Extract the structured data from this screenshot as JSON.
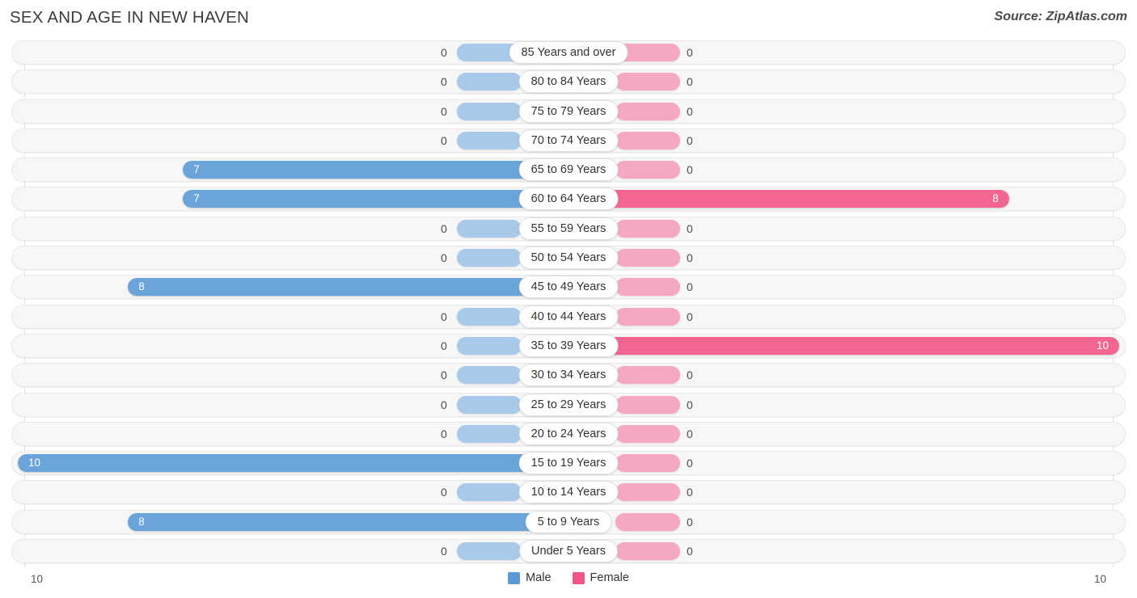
{
  "header": {
    "title": "SEX AND AGE IN NEW HAVEN",
    "source": "Source: ZipAtlas.com"
  },
  "legend": {
    "male_label": "Male",
    "female_label": "Female",
    "male_color": "#5b9bd5",
    "female_color": "#f2548a"
  },
  "axis": {
    "left_max_label": "10",
    "right_max_label": "10"
  },
  "chart_data": {
    "type": "bar",
    "title": "SEX AND AGE IN NEW HAVEN",
    "subtitle": "Source: ZipAtlas.com",
    "xlabel": "",
    "ylabel": "",
    "orientation": "horizontal",
    "style": "population-pyramid",
    "grid": true,
    "legend_position": "bottom-center",
    "xlim_left": [
      0,
      10
    ],
    "xlim_right": [
      0,
      10
    ],
    "categories": [
      "85 Years and over",
      "80 to 84 Years",
      "75 to 79 Years",
      "70 to 74 Years",
      "65 to 69 Years",
      "60 to 64 Years",
      "55 to 59 Years",
      "50 to 54 Years",
      "45 to 49 Years",
      "40 to 44 Years",
      "35 to 39 Years",
      "30 to 34 Years",
      "25 to 29 Years",
      "20 to 24 Years",
      "15 to 19 Years",
      "10 to 14 Years",
      "5 to 9 Years",
      "Under 5 Years"
    ],
    "series": [
      {
        "name": "Male",
        "color": "#5b9bd5",
        "values": [
          0,
          0,
          0,
          0,
          7,
          7,
          0,
          0,
          8,
          0,
          0,
          0,
          0,
          0,
          10,
          0,
          8,
          0
        ]
      },
      {
        "name": "Female",
        "color": "#f2548a",
        "values": [
          0,
          0,
          0,
          0,
          0,
          8,
          0,
          0,
          0,
          0,
          10,
          0,
          0,
          0,
          0,
          0,
          0,
          0
        ]
      }
    ]
  },
  "rows": [
    {
      "label": "85 Years and over",
      "male": "0",
      "female": "0"
    },
    {
      "label": "80 to 84 Years",
      "male": "0",
      "female": "0"
    },
    {
      "label": "75 to 79 Years",
      "male": "0",
      "female": "0"
    },
    {
      "label": "70 to 74 Years",
      "male": "0",
      "female": "0"
    },
    {
      "label": "65 to 69 Years",
      "male": "7",
      "female": "0"
    },
    {
      "label": "60 to 64 Years",
      "male": "7",
      "female": "8"
    },
    {
      "label": "55 to 59 Years",
      "male": "0",
      "female": "0"
    },
    {
      "label": "50 to 54 Years",
      "male": "0",
      "female": "0"
    },
    {
      "label": "45 to 49 Years",
      "male": "8",
      "female": "0"
    },
    {
      "label": "40 to 44 Years",
      "male": "0",
      "female": "0"
    },
    {
      "label": "35 to 39 Years",
      "male": "0",
      "female": "10"
    },
    {
      "label": "30 to 34 Years",
      "male": "0",
      "female": "0"
    },
    {
      "label": "25 to 29 Years",
      "male": "0",
      "female": "0"
    },
    {
      "label": "20 to 24 Years",
      "male": "0",
      "female": "0"
    },
    {
      "label": "15 to 19 Years",
      "male": "10",
      "female": "0"
    },
    {
      "label": "10 to 14 Years",
      "male": "0",
      "female": "0"
    },
    {
      "label": "5 to 9 Years",
      "male": "8",
      "female": "0"
    },
    {
      "label": "Under 5 Years",
      "male": "0",
      "female": "0"
    }
  ]
}
